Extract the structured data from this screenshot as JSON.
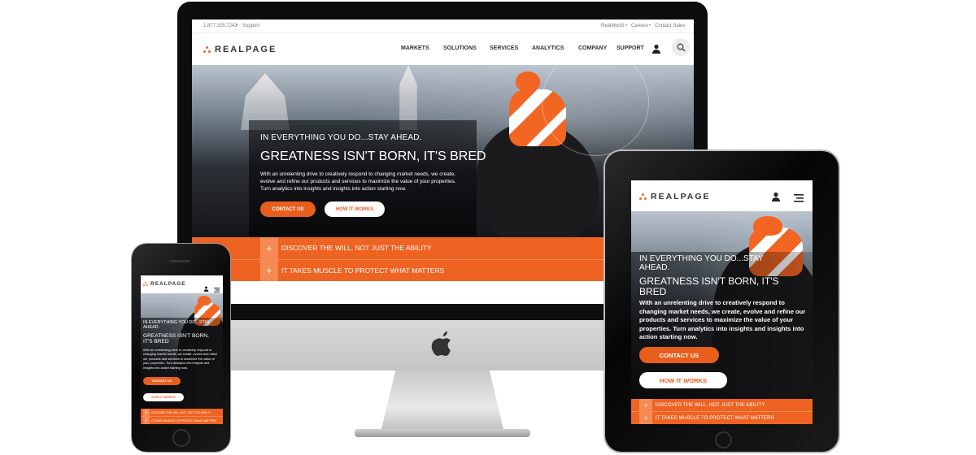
{
  "site": {
    "brand": "REALPAGE",
    "utility": {
      "phone": "1.877.325.7243",
      "support": "Support",
      "right_links": [
        "RealWorld",
        "Careers",
        "Contact Sales"
      ]
    },
    "nav": [
      "MARKETS",
      "SOLUTIONS",
      "SERVICES",
      "ANALYTICS",
      "COMPANY",
      "SUPPORT"
    ],
    "hero": {
      "eyebrow": "IN EVERYTHING YOU DO...STAY AHEAD.",
      "title": "GREATNESS ISN'T BORN, IT'S BRED",
      "body": "With an unrelenting drive to creatively respond to changing market needs, we create, evolve and refine our products and services to maximize the value of your properties. Turn analytics into insights and insights into action starting now.",
      "cta_primary": "CONTACT US",
      "cta_secondary": "HOW IT WORKS"
    },
    "accordion": [
      "DISCOVER THE WILL, NOT JUST THE ABILITY",
      "IT TAKES MUSCLE TO PROTECT WHAT MATTERS"
    ],
    "plus": "+"
  },
  "icons": [
    "user-icon",
    "search-icon",
    "menu-icon",
    "apple-logo-icon"
  ],
  "colors": {
    "accent": "#e85e1c",
    "accordion": "#ee6322",
    "device_frame": "#111111"
  }
}
